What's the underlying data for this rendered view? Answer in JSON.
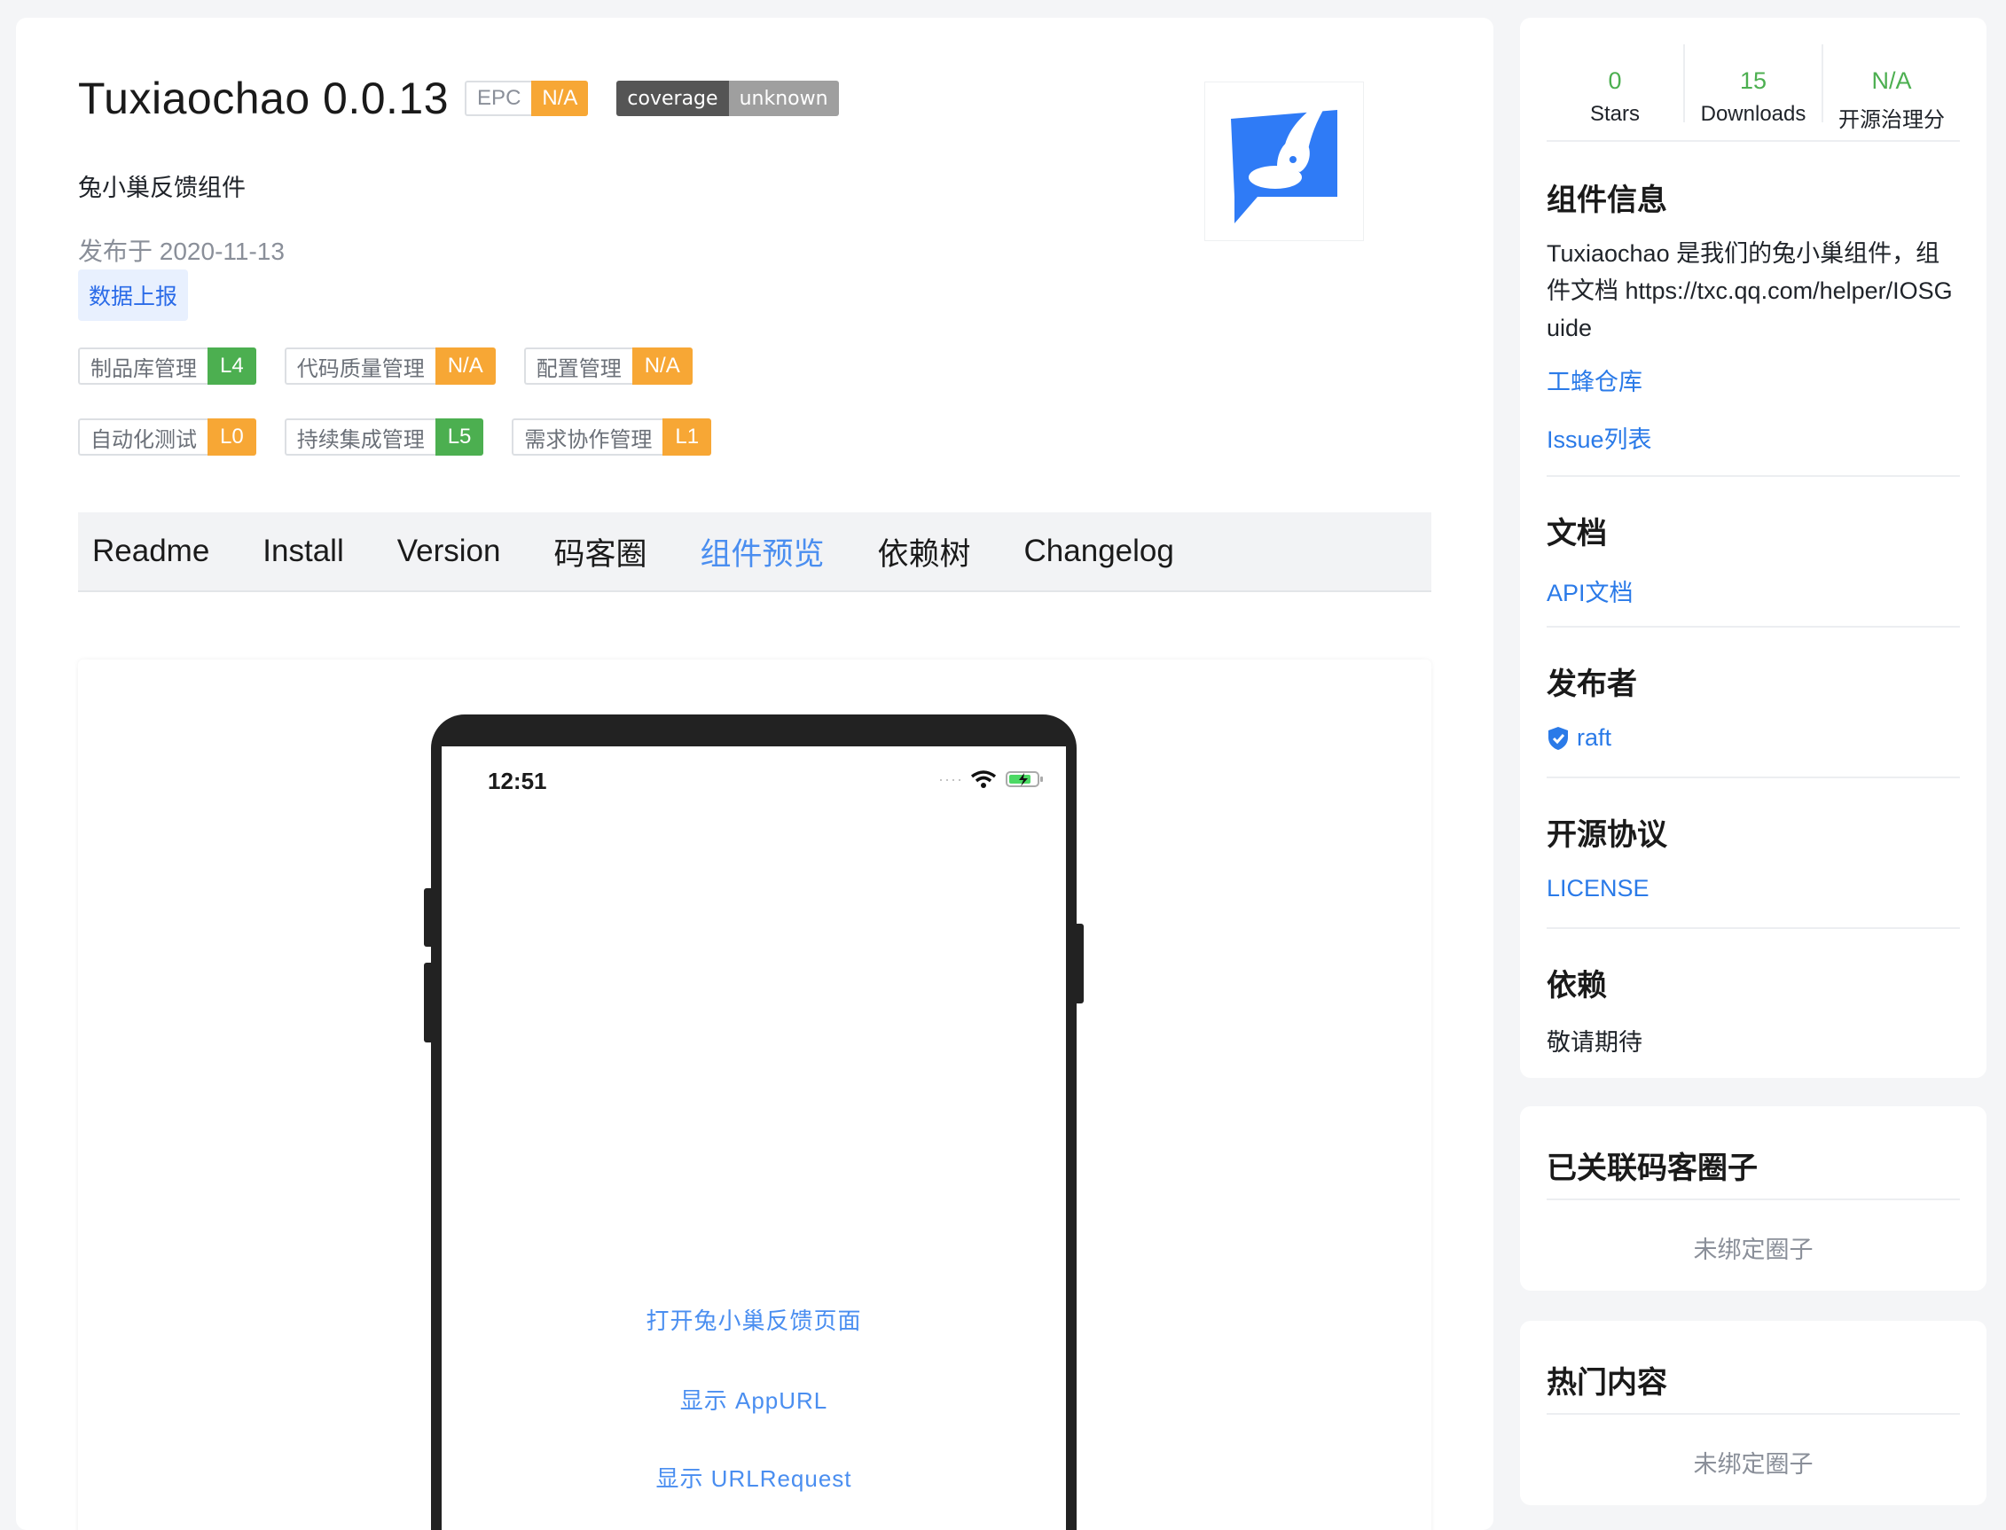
{
  "package": {
    "title": "Tuxiaochao 0.0.13",
    "epc_label": "EPC",
    "epc_value": "N/A",
    "coverage_label": "coverage",
    "coverage_value": "unknown",
    "description": "兔小巢反馈组件",
    "published": "发布于 2020-11-13",
    "tag": "数据上报"
  },
  "levels": [
    {
      "label": "制品库管理",
      "value": "L4",
      "color": "#4caf50"
    },
    {
      "label": "代码质量管理",
      "value": "N/A",
      "color": "#f7a735"
    },
    {
      "label": "配置管理",
      "value": "N/A",
      "color": "#f7a735"
    },
    {
      "label": "自动化测试",
      "value": "L0",
      "color": "#f7a735"
    },
    {
      "label": "持续集成管理",
      "value": "L5",
      "color": "#4caf50"
    },
    {
      "label": "需求协作管理",
      "value": "L1",
      "color": "#f7a735"
    }
  ],
  "tabs": [
    "Readme",
    "Install",
    "Version",
    "码客圈",
    "组件预览",
    "依赖树",
    "Changelog"
  ],
  "active_tab": "组件预览",
  "preview": {
    "time": "12:51",
    "links": [
      "打开兔小巢反馈页面",
      "显示 AppURL",
      "显示 URLRequest"
    ]
  },
  "stats": [
    {
      "value": "0",
      "label": "Stars"
    },
    {
      "value": "15",
      "label": "Downloads"
    },
    {
      "value": "N/A",
      "label": "开源治理分"
    }
  ],
  "sidebar": {
    "info_title": "组件信息",
    "info_text": "Tuxiaochao 是我们的兔小巢组件，组件文档 https://txc.qq.com/helper/IOSGuide",
    "repo_link": "工蜂仓库",
    "issue_link": "Issue列表",
    "docs_title": "文档",
    "api_link": "API文档",
    "publisher_title": "发布者",
    "publisher": "raft",
    "license_title": "开源协议",
    "license_link": "LICENSE",
    "deps_title": "依赖",
    "deps_text": "敬请期待",
    "circles_title": "已关联码客圈子",
    "circles_empty": "未绑定圈子",
    "hot_title": "热门内容",
    "hot_empty": "未绑定圈子"
  },
  "colors": {
    "accent": "#4a8ef0",
    "link": "#2a7ae8",
    "green": "#4caf50",
    "orange": "#f7a735",
    "logo_blue": "#2f7bf6"
  }
}
